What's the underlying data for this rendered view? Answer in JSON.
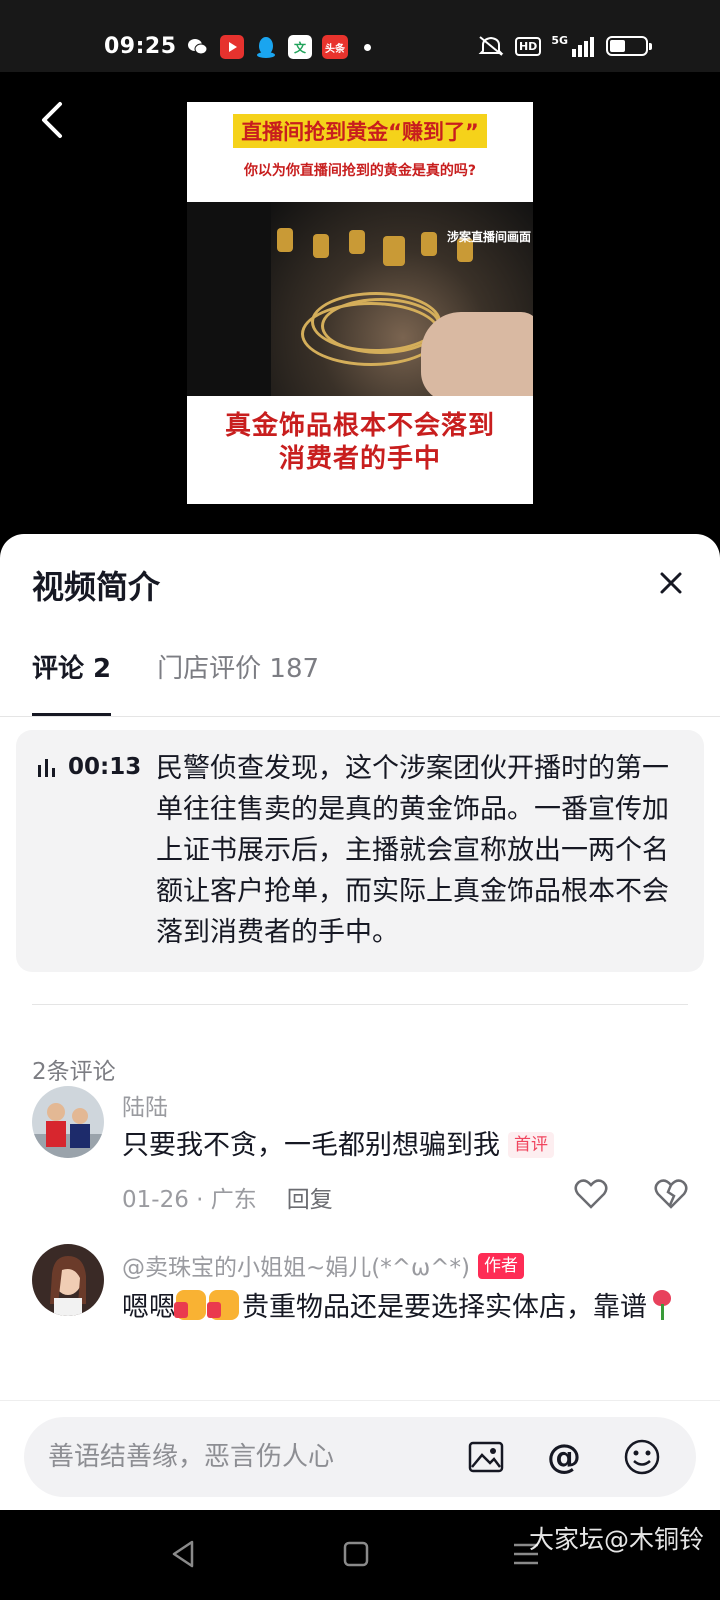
{
  "status_bar": {
    "time": "09:25",
    "apps": [
      {
        "icon": "wechat-icon",
        "label": "",
        "color": "#181818"
      },
      {
        "icon": "video-app-icon",
        "label": "",
        "color": "#e6322e"
      },
      {
        "icon": "qq-icon",
        "label": "",
        "color": "#1aa5f0"
      },
      {
        "icon": "wenku-app-icon",
        "label": "文",
        "color": "#21a35b"
      },
      {
        "icon": "toutiao-icon",
        "label": "头条",
        "color": "#e8332d"
      }
    ],
    "network_badge": "HD",
    "network_type": "5G",
    "battery_level": 0.45
  },
  "video": {
    "headline": "直播间抢到黄金“赚到了”",
    "question": "你以为你直播间抢到的黄金是真的吗?",
    "tag": "涉案直播间画面",
    "caption_line1": "真金饰品根本不会落到",
    "caption_line2": "消费者的手中"
  },
  "sheet": {
    "title": "视频简介",
    "tabs": [
      {
        "label": "评论 2",
        "active": true
      },
      {
        "label": "门店评价 187",
        "active": false
      }
    ],
    "summary": {
      "timestamp": "00:13",
      "text": "民警侦查发现，这个涉案团伙开播时的第一单往往售卖的是真的黄金饰品。一番宣传加上证书展示后，主播就会宣称放出一两个名额让客户抢单，而实际上真金饰品根本不会落到消费者的手中。"
    },
    "comment_count": "2条评论",
    "comments": [
      {
        "name": "陆陆",
        "text": "只要我不贪，一毛都别想骗到我",
        "badge": "首评",
        "date": "01-26 · 广东",
        "reply": "回复"
      },
      {
        "name": "@卖珠宝的小姐姐~娟儿(*^ω^*)",
        "badge": "作者",
        "text_prefix": "嗯嗯",
        "text_main": "贵重物品还是要选择实体店，靠谱"
      }
    ]
  },
  "input": {
    "placeholder": "善语结善缘，恶言伤人心"
  },
  "watermark": "大家坛@木铜铃"
}
